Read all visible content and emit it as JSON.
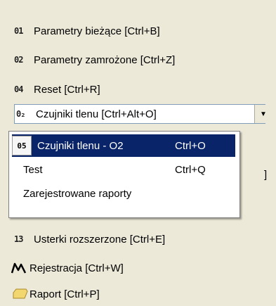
{
  "items": [
    {
      "code": "01",
      "label": "Parametry bieżące [Ctrl+B]"
    },
    {
      "code": "02",
      "label": "Parametry zamrożone [Ctrl+Z]"
    },
    {
      "code": "04",
      "label": "Reset [Ctrl+R]"
    }
  ],
  "highlighted": {
    "code": "0₂",
    "label": "Czujniki tlenu [Ctrl+Alt+O]",
    "dropdown_icon": "chevron-down-icon"
  },
  "menu": {
    "rows": [
      {
        "num": "05",
        "label": "Czujniki tlenu - O2",
        "shortcut": "Ctrl+O"
      },
      {
        "label": "Test",
        "shortcut": "Ctrl+Q"
      },
      {
        "label": "Zarejestrowane raporty",
        "shortcut": ""
      }
    ]
  },
  "behind_text": "]",
  "lower_items": [
    {
      "code": "13",
      "label": "Usterki rozszerzone [Ctrl+E]",
      "icon": ""
    },
    {
      "code": "",
      "label": "Rejestracja [Ctrl+W]",
      "icon": "chart-line-icon"
    },
    {
      "code": "",
      "label": "Raport [Ctrl+P]",
      "icon": "folder-icon"
    }
  ],
  "colors": {
    "selection": "#0a246a",
    "background": "#ece9d8"
  }
}
